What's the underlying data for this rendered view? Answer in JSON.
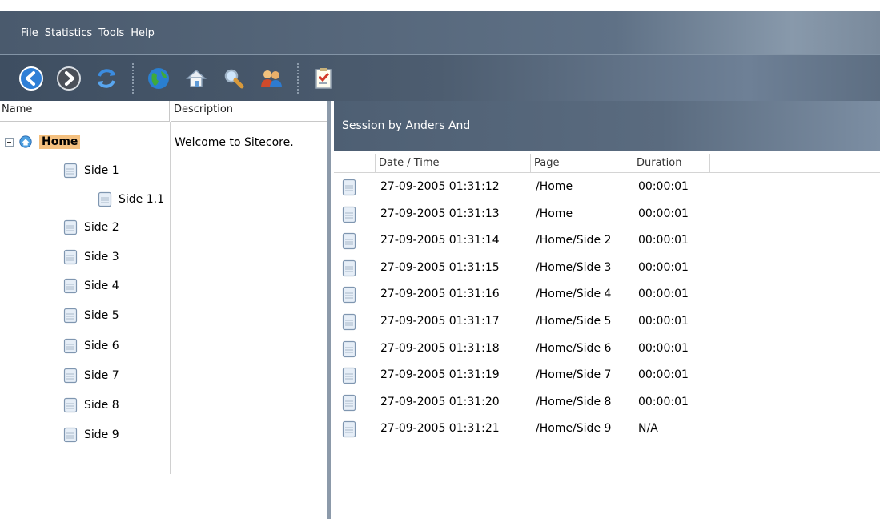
{
  "menu": {
    "items": [
      "File",
      "Statistics",
      "Tools",
      "Help"
    ]
  },
  "toolbar": {
    "buttons": [
      "back-icon",
      "forward-icon",
      "refresh-icon",
      "globe-icon",
      "home-icon",
      "search-icon",
      "users-icon",
      "checklist-icon"
    ]
  },
  "tree": {
    "col_name": "Name",
    "col_description": "Description",
    "root": {
      "label": "Home",
      "description": "Welcome to Sitecore."
    },
    "items": [
      {
        "label": "Side 1"
      },
      {
        "label": "Side 1.1"
      },
      {
        "label": "Side 2"
      },
      {
        "label": "Side 3"
      },
      {
        "label": "Side 4"
      },
      {
        "label": "Side 5"
      },
      {
        "label": "Side 6"
      },
      {
        "label": "Side 7"
      },
      {
        "label": "Side 8"
      },
      {
        "label": "Side 9"
      }
    ]
  },
  "session": {
    "title": "Session by Anders And",
    "columns": [
      "Date / Time",
      "Page",
      "Duration"
    ],
    "rows": [
      {
        "datetime": "27-09-2005 01:31:12",
        "page": "/Home",
        "duration": "00:00:01"
      },
      {
        "datetime": "27-09-2005 01:31:13",
        "page": "/Home",
        "duration": "00:00:01"
      },
      {
        "datetime": "27-09-2005 01:31:14",
        "page": "/Home/Side 2",
        "duration": "00:00:01"
      },
      {
        "datetime": "27-09-2005 01:31:15",
        "page": "/Home/Side 3",
        "duration": "00:00:01"
      },
      {
        "datetime": "27-09-2005 01:31:16",
        "page": "/Home/Side 4",
        "duration": "00:00:01"
      },
      {
        "datetime": "27-09-2005 01:31:17",
        "page": "/Home/Side 5",
        "duration": "00:00:01"
      },
      {
        "datetime": "27-09-2005 01:31:18",
        "page": "/Home/Side 6",
        "duration": "00:00:01"
      },
      {
        "datetime": "27-09-2005 01:31:19",
        "page": "/Home/Side 7",
        "duration": "00:00:01"
      },
      {
        "datetime": "27-09-2005 01:31:20",
        "page": "/Home/Side 8",
        "duration": "00:00:01"
      },
      {
        "datetime": "27-09-2005 01:31:21",
        "page": "/Home/Side 9",
        "duration": "N/A"
      }
    ]
  },
  "colors": {
    "chrome": "#56677b",
    "home_highlight": "#f4c07f"
  }
}
